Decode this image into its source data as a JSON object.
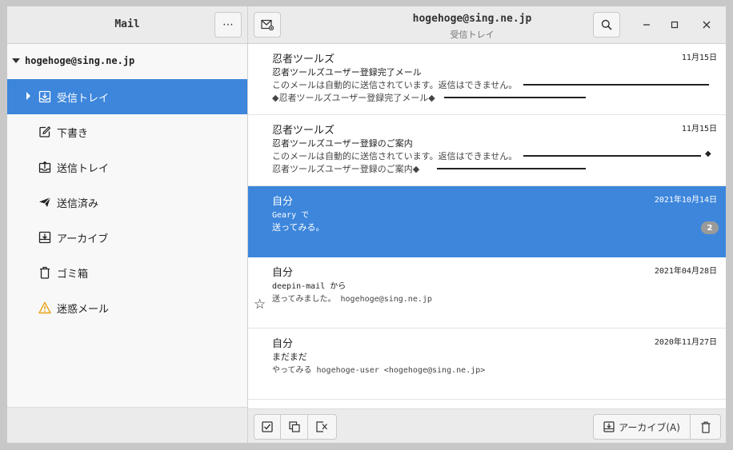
{
  "header": {
    "app_title": "Mail",
    "more_label": "⋯",
    "account_title": "hogehoge@sing.ne.jp",
    "folder_subtitle": "受信トレイ"
  },
  "sidebar": {
    "account": "hogehoge@sing.ne.jp",
    "folders": [
      {
        "label": "受信トレイ",
        "icon": "inbox-icon"
      },
      {
        "label": "下書き",
        "icon": "drafts-icon"
      },
      {
        "label": "送信トレイ",
        "icon": "outbox-icon"
      },
      {
        "label": "送信済み",
        "icon": "sent-icon"
      },
      {
        "label": "アーカイブ",
        "icon": "archive-icon"
      },
      {
        "label": "ゴミ箱",
        "icon": "trash-icon"
      },
      {
        "label": "迷惑メール",
        "icon": "junk-icon"
      }
    ]
  },
  "messages": [
    {
      "from": "忍者ツールズ",
      "date": "11月15日",
      "subject": "忍者ツールズユーザー登録完了メール",
      "preview1": "このメールは自動的に送信されています。返信はできません。",
      "preview2": "◆忍者ツールズユーザー登録完了メール◆"
    },
    {
      "from": "忍者ツールズ",
      "date": "11月15日",
      "subject": "忍者ツールズユーザー登録のご案内",
      "preview1": "このメールは自動的に送信されています。返信はできません。",
      "preview2": "忍者ツールズユーザー登録のご案内◆",
      "preview1_end": "◆"
    },
    {
      "from": "自分",
      "date": "2021年10月14日",
      "subject": "Geary で",
      "preview1": "送ってみる。",
      "badge": "2"
    },
    {
      "from": "自分",
      "date": "2021年04月28日",
      "subject": "deepin-mail から",
      "preview1": "送ってみました。 hogehoge@sing.ne.jp"
    },
    {
      "from": "自分",
      "date": "2020年11月27日",
      "subject": "まだまだ",
      "preview1": "やってみる hogehoge-user <hogehoge@sing.ne.jp>"
    }
  ],
  "toolbar": {
    "archive_label": "アーカイブ(A)"
  },
  "colors": {
    "selection": "#3d86dc",
    "header_bg": "#ebebeb",
    "warning": "#e8a317"
  }
}
